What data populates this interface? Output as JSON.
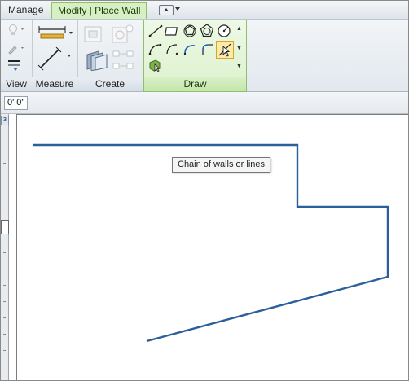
{
  "tabs": {
    "manage": "Manage",
    "modify_place_wall": "Modify | Place Wall"
  },
  "panels": {
    "view": "View",
    "measure": "Measure",
    "create": "Create",
    "draw": "Draw"
  },
  "options_bar": {
    "offset_value": "0' 0\""
  },
  "tooltip": {
    "text": "Chain of walls or lines"
  },
  "left_strip": {
    "badge": "3"
  },
  "colors": {
    "wall_line": "#2b5f9a",
    "context_tab": "#d6f0c4",
    "draw_panel": "#dcf1cd"
  },
  "icons": {
    "view": [
      "lightbulb-icon",
      "brush-icon",
      "thin-lines-icon"
    ],
    "measure": [
      "aligned-dimension-icon",
      "measure-between-icon"
    ],
    "create": [
      "create-group-icon",
      "create-similar-icon",
      "create-parts-icon",
      "create-assembly-icon"
    ],
    "draw": [
      "line-icon",
      "rectangle-icon",
      "inscribed-polygon-icon",
      "circumscribed-polygon-icon",
      "circle-icon",
      "start-end-arc-icon",
      "center-ends-arc-icon",
      "tangent-arc-icon",
      "fillet-arc-icon",
      "pick-lines-icon",
      "pick-faces-icon"
    ]
  }
}
